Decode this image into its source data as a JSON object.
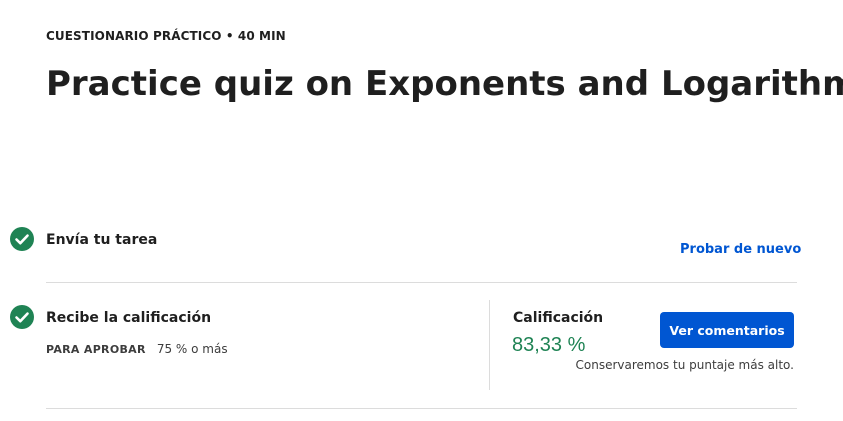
{
  "header": {
    "eyebrow": "CUESTIONARIO PRÁCTICO • 40 MIN",
    "title": "Practice quiz on Exponents and Logarithms"
  },
  "steps": [
    {
      "title": "Envía tu tarea",
      "status": "completed",
      "action_label": "Probar de nuevo"
    },
    {
      "title": "Recibe la calificación",
      "status": "completed",
      "pass_label": "PARA APROBAR",
      "pass_value": "75 % o más"
    }
  ],
  "grade": {
    "label": "Calificación",
    "value": "83,33 %",
    "button_label": "Ver comentarios",
    "note": "Conservaremos tu puntaje más alto."
  },
  "colors": {
    "accent": "#0056d2",
    "success": "#1f8354",
    "text": "#1f1f1f",
    "divider": "#dcdcdc"
  },
  "icons": {
    "step_status": "check-circle-icon"
  }
}
